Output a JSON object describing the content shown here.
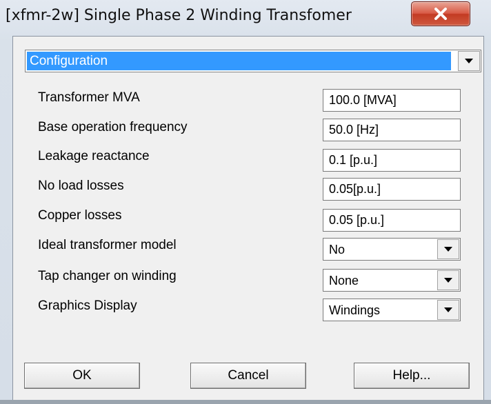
{
  "window": {
    "title": "[xfmr-2w] Single Phase 2 Winding Transfomer"
  },
  "section_select": {
    "value": "Configuration"
  },
  "params": [
    {
      "label": "Transformer MVA",
      "value": "100.0 [MVA]"
    },
    {
      "label": "Base operation frequency",
      "value": "50.0 [Hz]"
    },
    {
      "label": "Leakage reactance",
      "value": "0.1 [p.u.]"
    },
    {
      "label": "No load losses",
      "value": "0.05[p.u.]"
    },
    {
      "label": "Copper losses",
      "value": "0.05 [p.u.]"
    },
    {
      "label": "Ideal transformer model",
      "value": "No"
    },
    {
      "label": "Tap changer on winding",
      "value": "None"
    },
    {
      "label": "Graphics Display",
      "value": "Windings"
    }
  ],
  "buttons": {
    "ok": "OK",
    "cancel": "Cancel",
    "help": "Help..."
  },
  "icons": {
    "close": "close-icon",
    "dropdown": "chevron-down-icon"
  },
  "colors": {
    "selection": "#3399ff",
    "close_button": "#c33a22"
  }
}
